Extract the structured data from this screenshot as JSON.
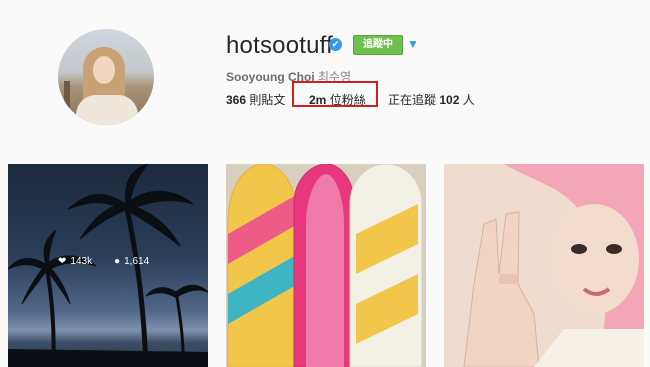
{
  "profile": {
    "username": "hotsootuff",
    "verified_symbol": "✔",
    "follow_button_label": "追蹤中",
    "dropdown_symbol": "▼",
    "full_name_latin": "Sooyoung Choi",
    "full_name_korean": "최수영",
    "stats": {
      "posts_value": "366",
      "posts_label": "則貼文",
      "followers_value": "2m",
      "followers_label": "位粉絲",
      "following_prefix": "正在追蹤",
      "following_value": "102",
      "following_suffix": "人"
    }
  },
  "grid": {
    "tile1": {
      "likes": "143k",
      "comments": "1,614"
    }
  },
  "colors": {
    "follow_button": "#70c050",
    "verified": "#3897f0",
    "highlight": "#d01f1f"
  }
}
